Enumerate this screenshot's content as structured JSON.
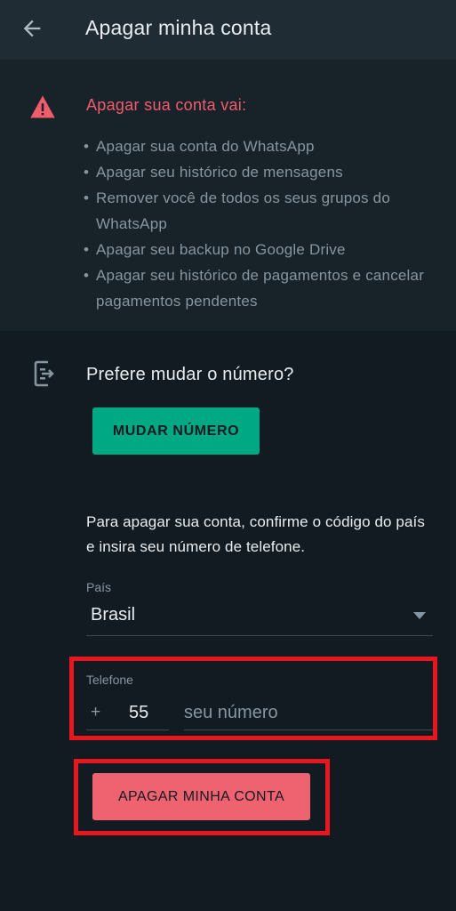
{
  "header": {
    "title": "Apagar minha conta",
    "back_icon": "arrow-left-icon"
  },
  "warning": {
    "icon": "warning-triangle-icon",
    "title": "Apagar sua conta vai:",
    "items": [
      "Apagar sua conta do WhatsApp",
      "Apagar seu histórico de mensagens",
      "Remover você de todos os seus grupos do WhatsApp",
      "Apagar seu backup no Google Drive",
      "Apagar seu histórico de pagamentos e cancelar pagamentos pendentes"
    ],
    "bullet": "•"
  },
  "change_number": {
    "icon": "phone-change-icon",
    "title": "Prefere mudar o número?",
    "button_label": "MUDAR NÚMERO"
  },
  "confirm": {
    "text": "Para apagar sua conta, confirme o código do país e insira seu número de telefone.",
    "country_label": "País",
    "country_value": "Brasil",
    "phone_label": "Telefone",
    "plus": "+",
    "country_code": "55",
    "phone_placeholder": "seu número"
  },
  "delete": {
    "button_label": "APAGAR MINHA CONTA"
  },
  "colors": {
    "background": "#121b22",
    "appbar": "#1f2c34",
    "accent_green": "#00a884",
    "danger": "#f15c6d",
    "highlight_box": "#e8171f"
  }
}
